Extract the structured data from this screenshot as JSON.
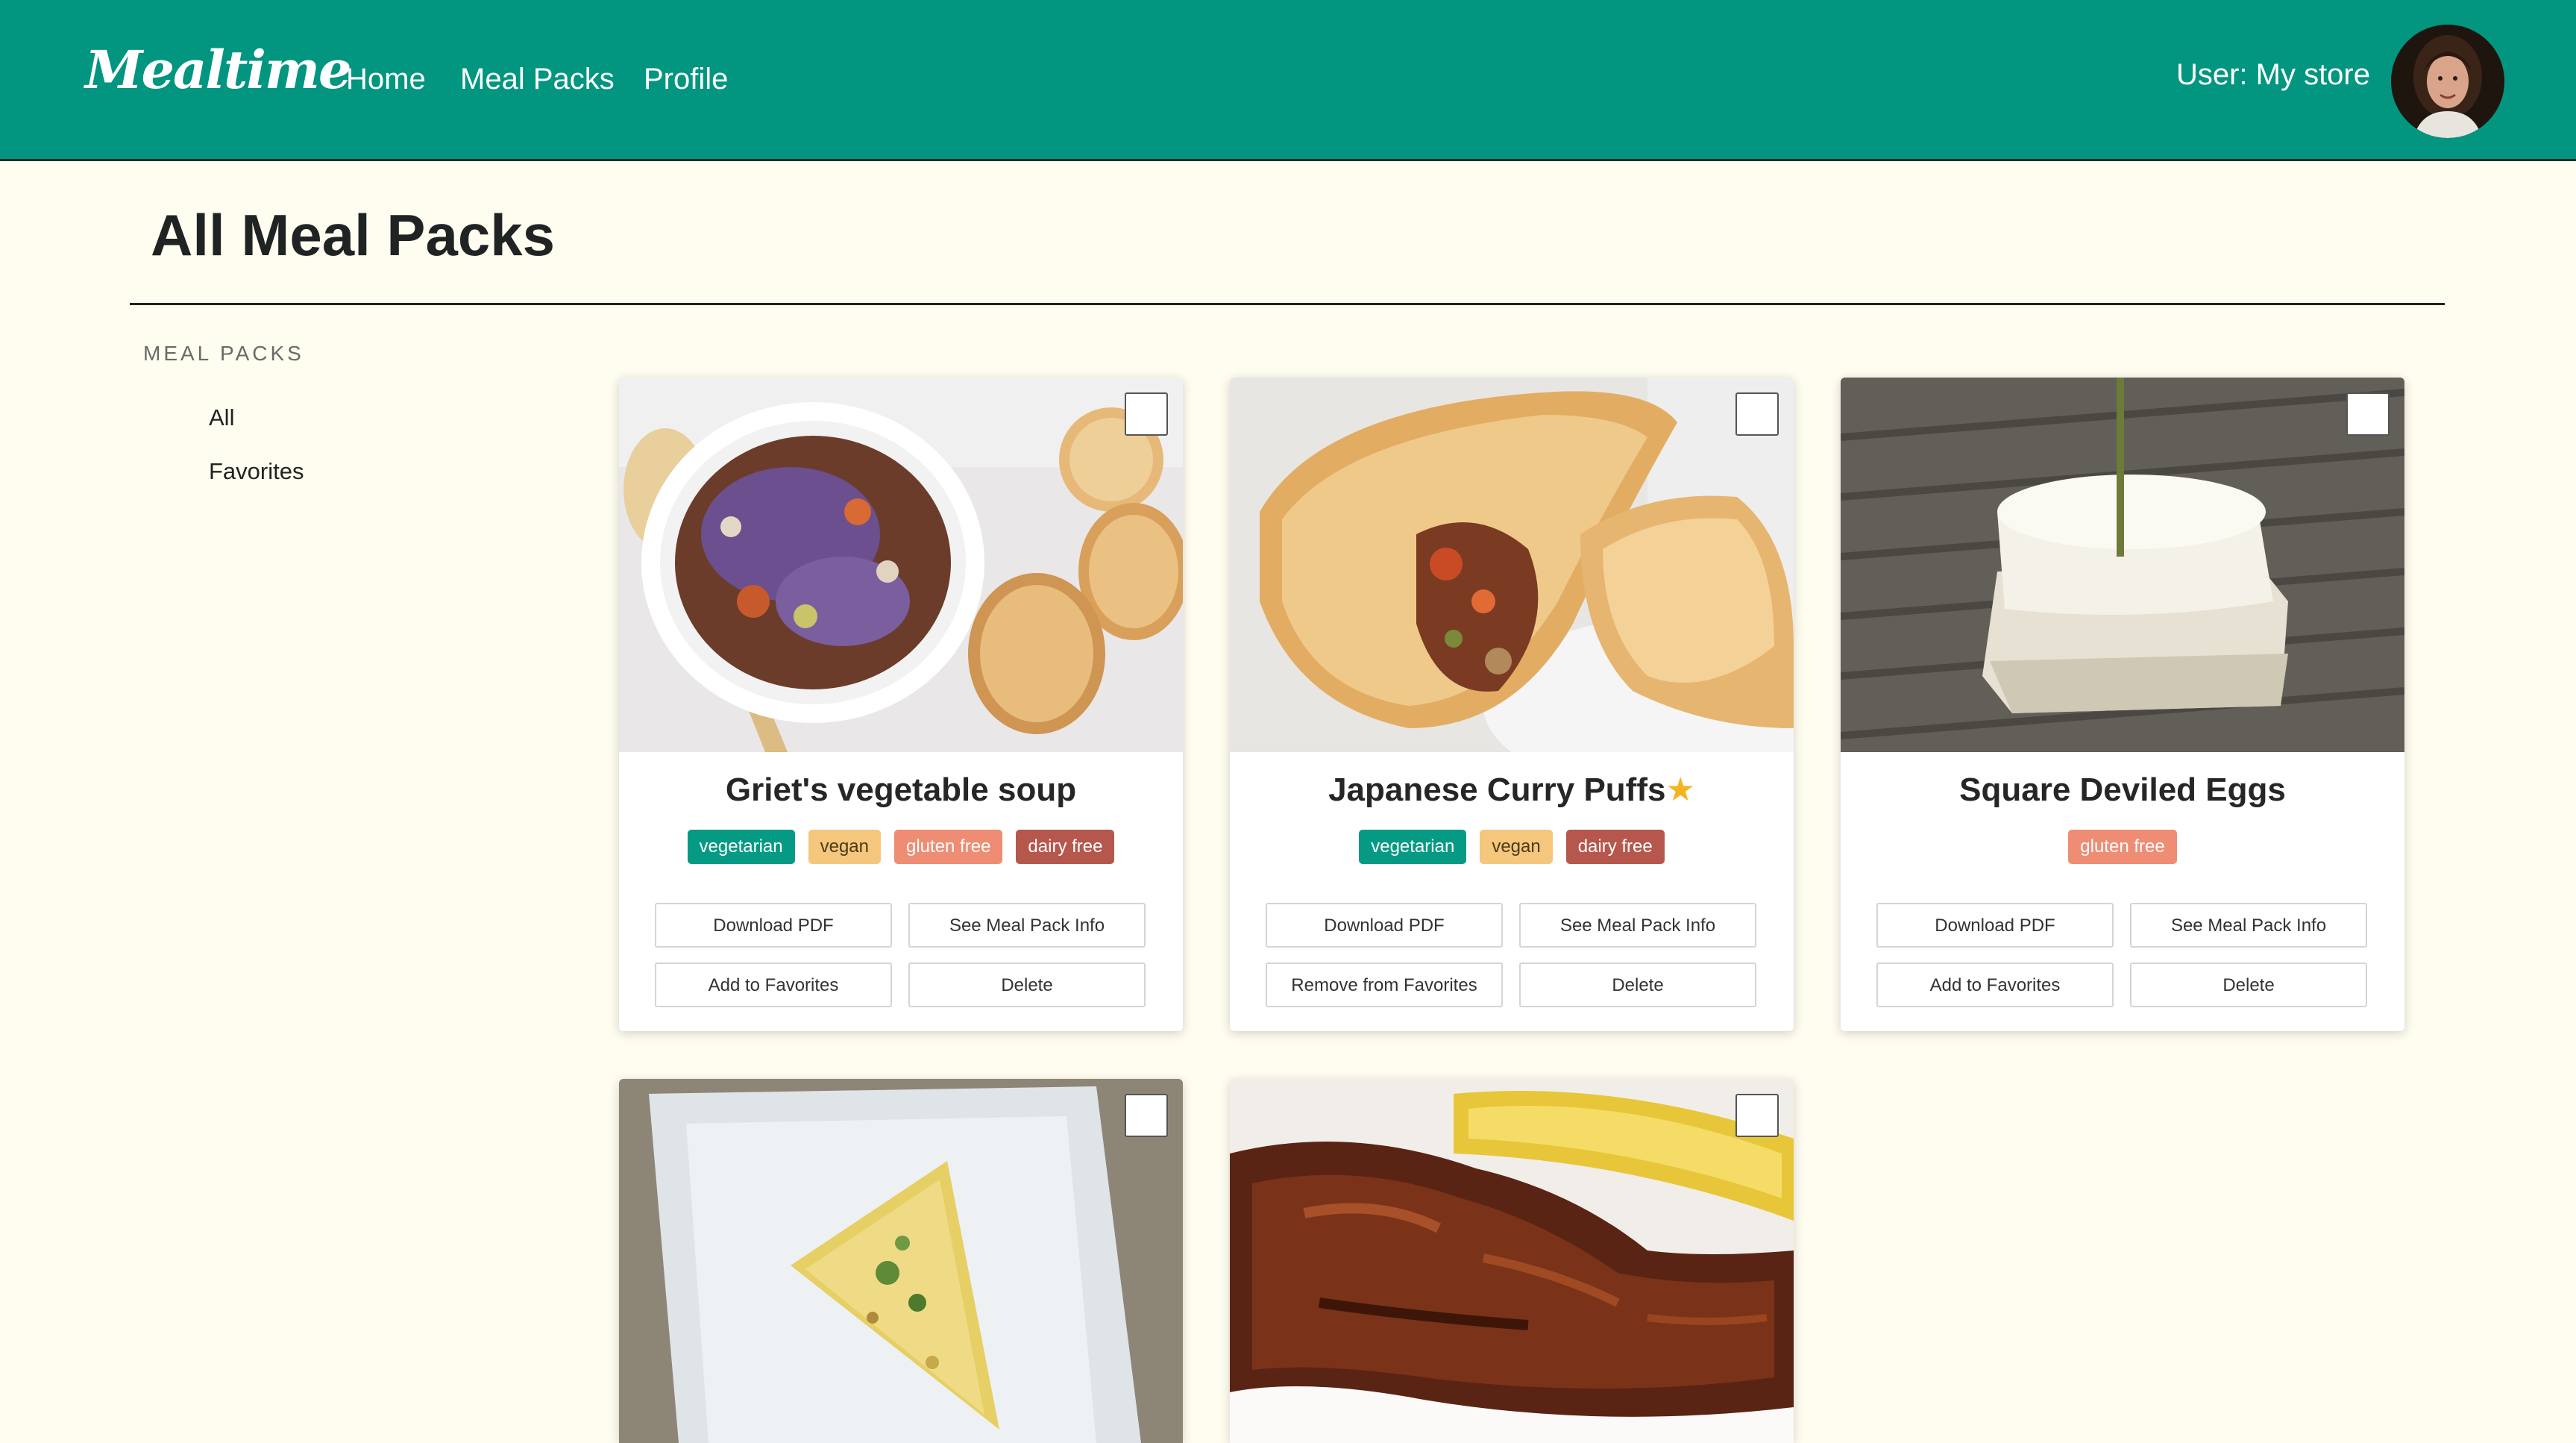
{
  "header": {
    "logo": "Mealtime",
    "nav": [
      "Home",
      "Meal Packs",
      "Profile"
    ],
    "user_label": "User: My store",
    "colors": {
      "bar": "#029580",
      "text": "#ffffff"
    }
  },
  "page": {
    "title": "All Meal Packs",
    "background": "#fffdf0"
  },
  "sidebar": {
    "heading": "MEAL PACKS",
    "items": [
      "All",
      "Favorites"
    ]
  },
  "cards": [
    {
      "title": "Griet's vegetable soup",
      "favorite": false,
      "image": "vegetable-soup-photo",
      "tags": [
        "vegetarian",
        "vegan",
        "gluten free",
        "dairy free"
      ],
      "buttons": [
        "Download PDF",
        "See Meal Pack Info",
        "Add to Favorites",
        "Delete"
      ]
    },
    {
      "title": "Japanese Curry Puffs",
      "favorite": true,
      "image": "curry-puff-photo",
      "tags": [
        "vegetarian",
        "vegan",
        "dairy free"
      ],
      "buttons": [
        "Download PDF",
        "See Meal Pack Info",
        "Remove from Favorites",
        "Delete"
      ]
    },
    {
      "title": "Square Deviled Eggs",
      "favorite": false,
      "image": "deviled-eggs-photo",
      "tags": [
        "gluten free"
      ],
      "buttons": [
        "Download PDF",
        "See Meal Pack Info",
        "Add to Favorites",
        "Delete"
      ]
    },
    {
      "title": "",
      "image": "frittata-photo"
    },
    {
      "title": "",
      "image": "bbq-ribs-photo"
    }
  ],
  "tag_colors": {
    "vegetarian": "#069a85",
    "vegan": "#f4c77d",
    "gluten free": "#ee8d74",
    "dairy free": "#b6574d"
  },
  "favorite_icon": "star-icon",
  "favorite_color": "#f3b421"
}
